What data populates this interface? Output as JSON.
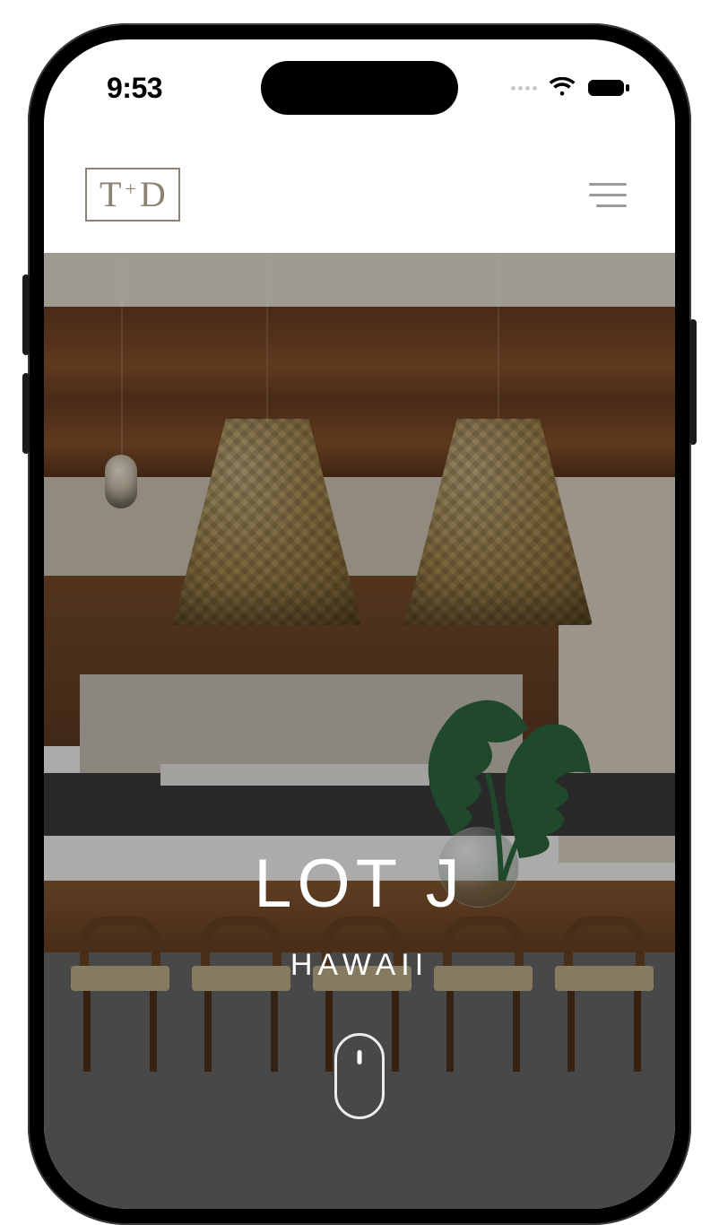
{
  "status": {
    "time": "9:53"
  },
  "header": {
    "logo": {
      "left": "T",
      "plus": "+",
      "right": "D"
    }
  },
  "hero": {
    "title": "LOT J",
    "subtitle": "HAWAII"
  }
}
